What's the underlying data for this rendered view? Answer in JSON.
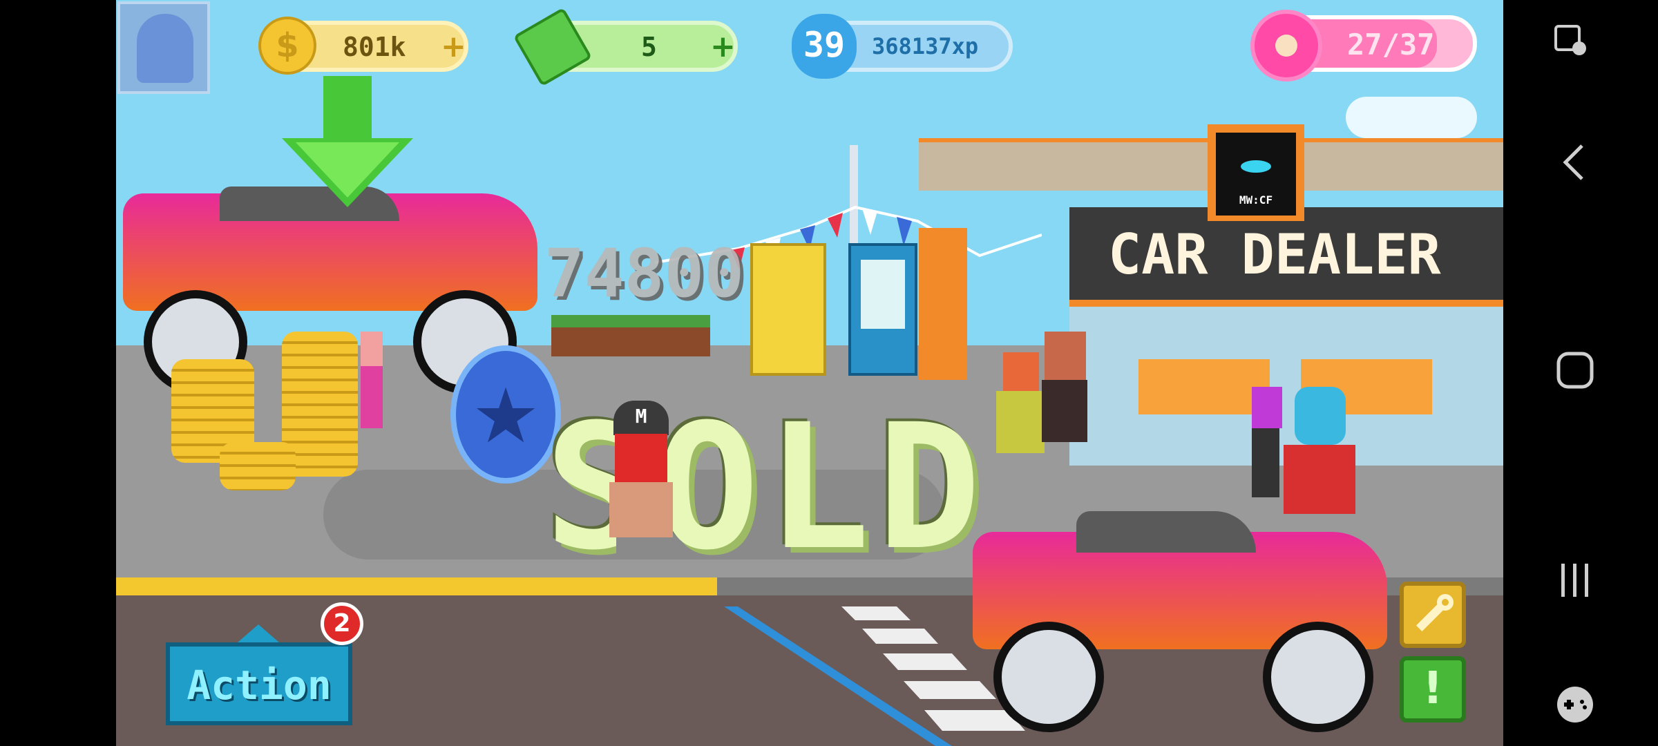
{
  "hud": {
    "coins": "801k",
    "coins_plus": "+",
    "cash": "5",
    "cash_plus": "+",
    "level": "39",
    "xp": "368137xp",
    "energy": "27/37"
  },
  "scene": {
    "floating_price": "74800",
    "sold_label": "SOLD",
    "dealer_sign": "CAR DEALER",
    "dealer_logo_text": "MW:CF",
    "player_cap_letter": "M"
  },
  "actions": {
    "action_label": "Action",
    "action_badge": "2",
    "wrench_icon": "wrench-icon",
    "alert_label": "!"
  },
  "colors": {
    "sky": "#86d8f4",
    "coin_gold": "#f5c431",
    "cash_green": "#5bc94a",
    "xp_blue": "#3aa6e8",
    "energy_pink": "#ff4aa8",
    "action_blue": "#1f9ec9",
    "car_pink": "#e82a9a"
  },
  "system_nav": {
    "icons": [
      "touch-icon",
      "back-icon",
      "home-icon",
      "recents-icon",
      "gamepad-icon"
    ]
  }
}
